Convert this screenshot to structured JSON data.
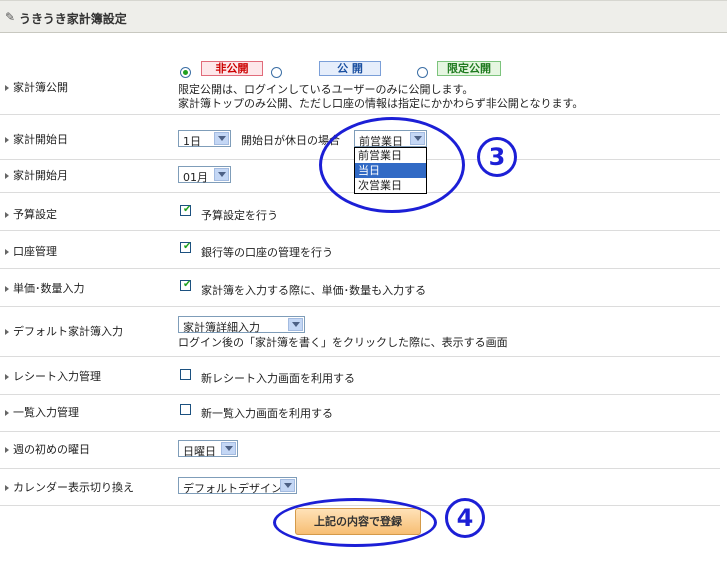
{
  "header": {
    "title": "うきうき家計簿設定",
    "icon": "pencil-icon"
  },
  "rows": {
    "publish": {
      "label": "家計簿公開",
      "options": [
        {
          "label": "非公開",
          "color": "#cc0000",
          "bg": "#fde7ea",
          "border": "#e16b7a",
          "checked": true
        },
        {
          "label": "公 開",
          "color": "#1a4fa0",
          "bg": "#e6eefb",
          "border": "#7b9fd8",
          "checked": false
        },
        {
          "label": "限定公開",
          "color": "#1f7a1f",
          "bg": "#e6f6e1",
          "border": "#7dc47d",
          "checked": false
        }
      ],
      "note1": "限定公開は、ログインしているユーザーのみに公開します。",
      "note2": "家計簿トップのみ公開、ただし口座の情報は指定にかかわらず非公開となります。"
    },
    "start_day": {
      "label": "家計開始日",
      "value": "1日",
      "holiday_label": "開始日が休日の場合",
      "holiday_value": "前営業日",
      "dropdown_options": [
        "前営業日",
        "当日",
        "次営業日"
      ],
      "dropdown_selected": "当日"
    },
    "start_month": {
      "label": "家計開始月",
      "value": "01月"
    },
    "budget": {
      "label": "予算設定",
      "checkbox_label": "予算設定を行う",
      "checked": true
    },
    "account": {
      "label": "口座管理",
      "checkbox_label": "銀行等の口座の管理を行う",
      "checked": true
    },
    "unit_price": {
      "label": "単価･数量入力",
      "checkbox_label": "家計簿を入力する際に、単価･数量も入力する",
      "checked": true
    },
    "default_input": {
      "label": "デフォルト家計簿入力",
      "value": "家計簿詳細入力",
      "note": "ログイン後の「家計簿を書く」をクリックした際に、表示する画面"
    },
    "receipt": {
      "label": "レシート入力管理",
      "checkbox_label": "新レシート入力画面を利用する",
      "checked": false
    },
    "list_input": {
      "label": "一覧入力管理",
      "checkbox_label": "新一覧入力画面を利用する",
      "checked": false
    },
    "week_start": {
      "label": "週の初めの曜日",
      "value": "日曜日"
    },
    "calendar": {
      "label": "カレンダー表示切り換え",
      "value": "デフォルトデザイン"
    }
  },
  "submit_label": "上記の内容で登録",
  "annotations": {
    "marker3": "3",
    "marker4": "4",
    "color": "#1c1fd6"
  }
}
